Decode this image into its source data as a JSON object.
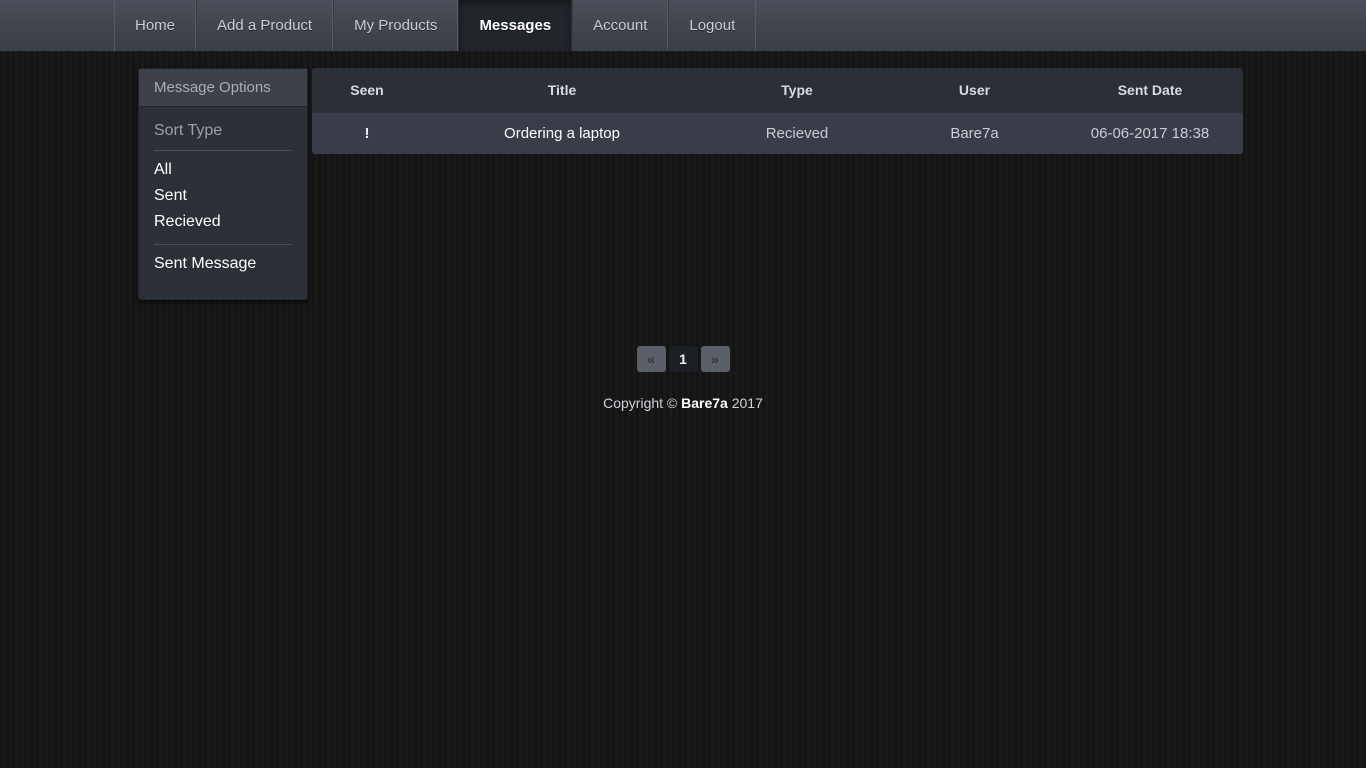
{
  "navbar": {
    "items": [
      {
        "label": "Home",
        "active": false
      },
      {
        "label": "Add a Product",
        "active": false
      },
      {
        "label": "My Products",
        "active": false
      },
      {
        "label": "Messages",
        "active": true
      },
      {
        "label": "Account",
        "active": false
      },
      {
        "label": "Logout",
        "active": false
      }
    ]
  },
  "sidebar": {
    "header": "Message Options",
    "sort_heading": "Sort Type",
    "sort_items": [
      {
        "label": "All"
      },
      {
        "label": "Sent"
      },
      {
        "label": "Recieved"
      }
    ],
    "actions": [
      {
        "label": "Sent Message"
      }
    ]
  },
  "table": {
    "headers": [
      "Seen",
      "Title",
      "Type",
      "User",
      "Sent Date"
    ],
    "rows": [
      {
        "seen": "!",
        "title": "Ordering a laptop",
        "type": "Recieved",
        "user": "Bare7a",
        "sent_date": "06-06-2017 18:38"
      }
    ]
  },
  "pagination": {
    "prev": "«",
    "next": "»",
    "pages": [
      "1"
    ],
    "current": "1"
  },
  "footer": {
    "prefix": "Copyright © ",
    "brand": "Bare7a",
    "suffix": " 2017"
  },
  "colors": {
    "page_bg": "#151515",
    "navbar_top": "#4a4f59",
    "navbar_bottom": "#3a3f47",
    "active_tab_bg": "#22262b",
    "panel_bg": "#2c3037",
    "panel_header_bg": "#3c414a",
    "table_header_bg": "#2b2f36",
    "table_row_bg": "#383d47",
    "text_primary": "#ffffff",
    "text_muted": "#9ba0a9"
  }
}
